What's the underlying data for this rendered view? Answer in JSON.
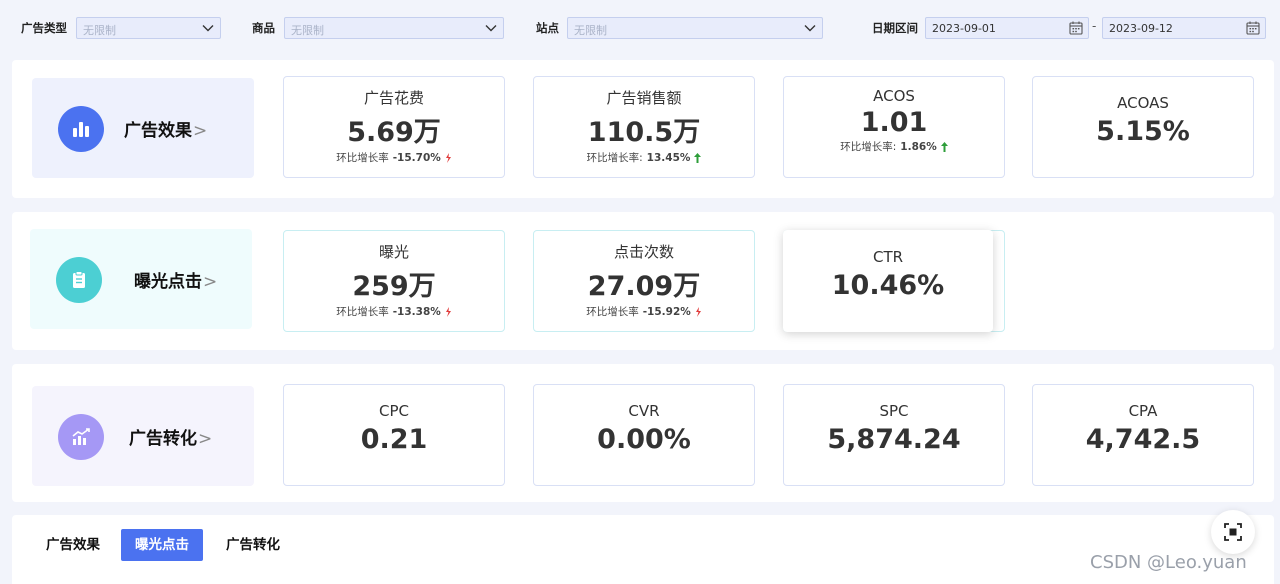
{
  "filters": {
    "ad_type_label": "广告类型",
    "ad_type_value": "无限制",
    "product_label": "商品",
    "product_value": "无限制",
    "site_label": "站点",
    "site_value": "无限制",
    "date_label": "日期区间",
    "date_start": "2023-09-01",
    "date_separator": "-",
    "date_end": "2023-09-12"
  },
  "sections": {
    "effect": {
      "title": "广告效果",
      "cards": [
        {
          "title": "广告花费",
          "value": "5.69万",
          "rate_label": "环比增长率",
          "rate": "-15.70%",
          "trend": "down"
        },
        {
          "title": "广告销售额",
          "value": "110.5万",
          "rate_label": "环比增长率:",
          "rate": "13.45%",
          "trend": "up"
        },
        {
          "title": "ACOS",
          "value": "1.01",
          "rate_label": "环比增长率:",
          "rate": "1.86%",
          "trend": "up"
        },
        {
          "title": "ACOAS",
          "value": "5.15%"
        }
      ]
    },
    "exposure": {
      "title": "曝光点击",
      "cards": [
        {
          "title": "曝光",
          "value": "259万",
          "rate_label": "环比增长率",
          "rate": "-13.38%",
          "trend": "down"
        },
        {
          "title": "点击次数",
          "value": "27.09万",
          "rate_label": "环比增长率",
          "rate": "-15.92%",
          "trend": "down"
        },
        {
          "title": "CTR",
          "value": "10.46%"
        }
      ]
    },
    "conversion": {
      "title": "广告转化",
      "cards": [
        {
          "title": "CPC",
          "value": "0.21"
        },
        {
          "title": "CVR",
          "value": "0.00%"
        },
        {
          "title": "SPC",
          "value": "5,874.24"
        },
        {
          "title": "CPA",
          "value": "4,742.5"
        }
      ]
    }
  },
  "tabs": [
    "广告效果",
    "曝光点击",
    "广告转化"
  ],
  "active_tab": "曝光点击",
  "watermark": "CSDN @Leo.yuan",
  "colors": {
    "accent": "#4b72f0",
    "up": "#2e9e3a",
    "down": "#e03b3b"
  },
  "icons": {
    "effect": "bar-chart-icon",
    "exposure": "clipboard-icon",
    "conversion": "trend-chart-icon",
    "fab": "fullscreen-icon"
  }
}
